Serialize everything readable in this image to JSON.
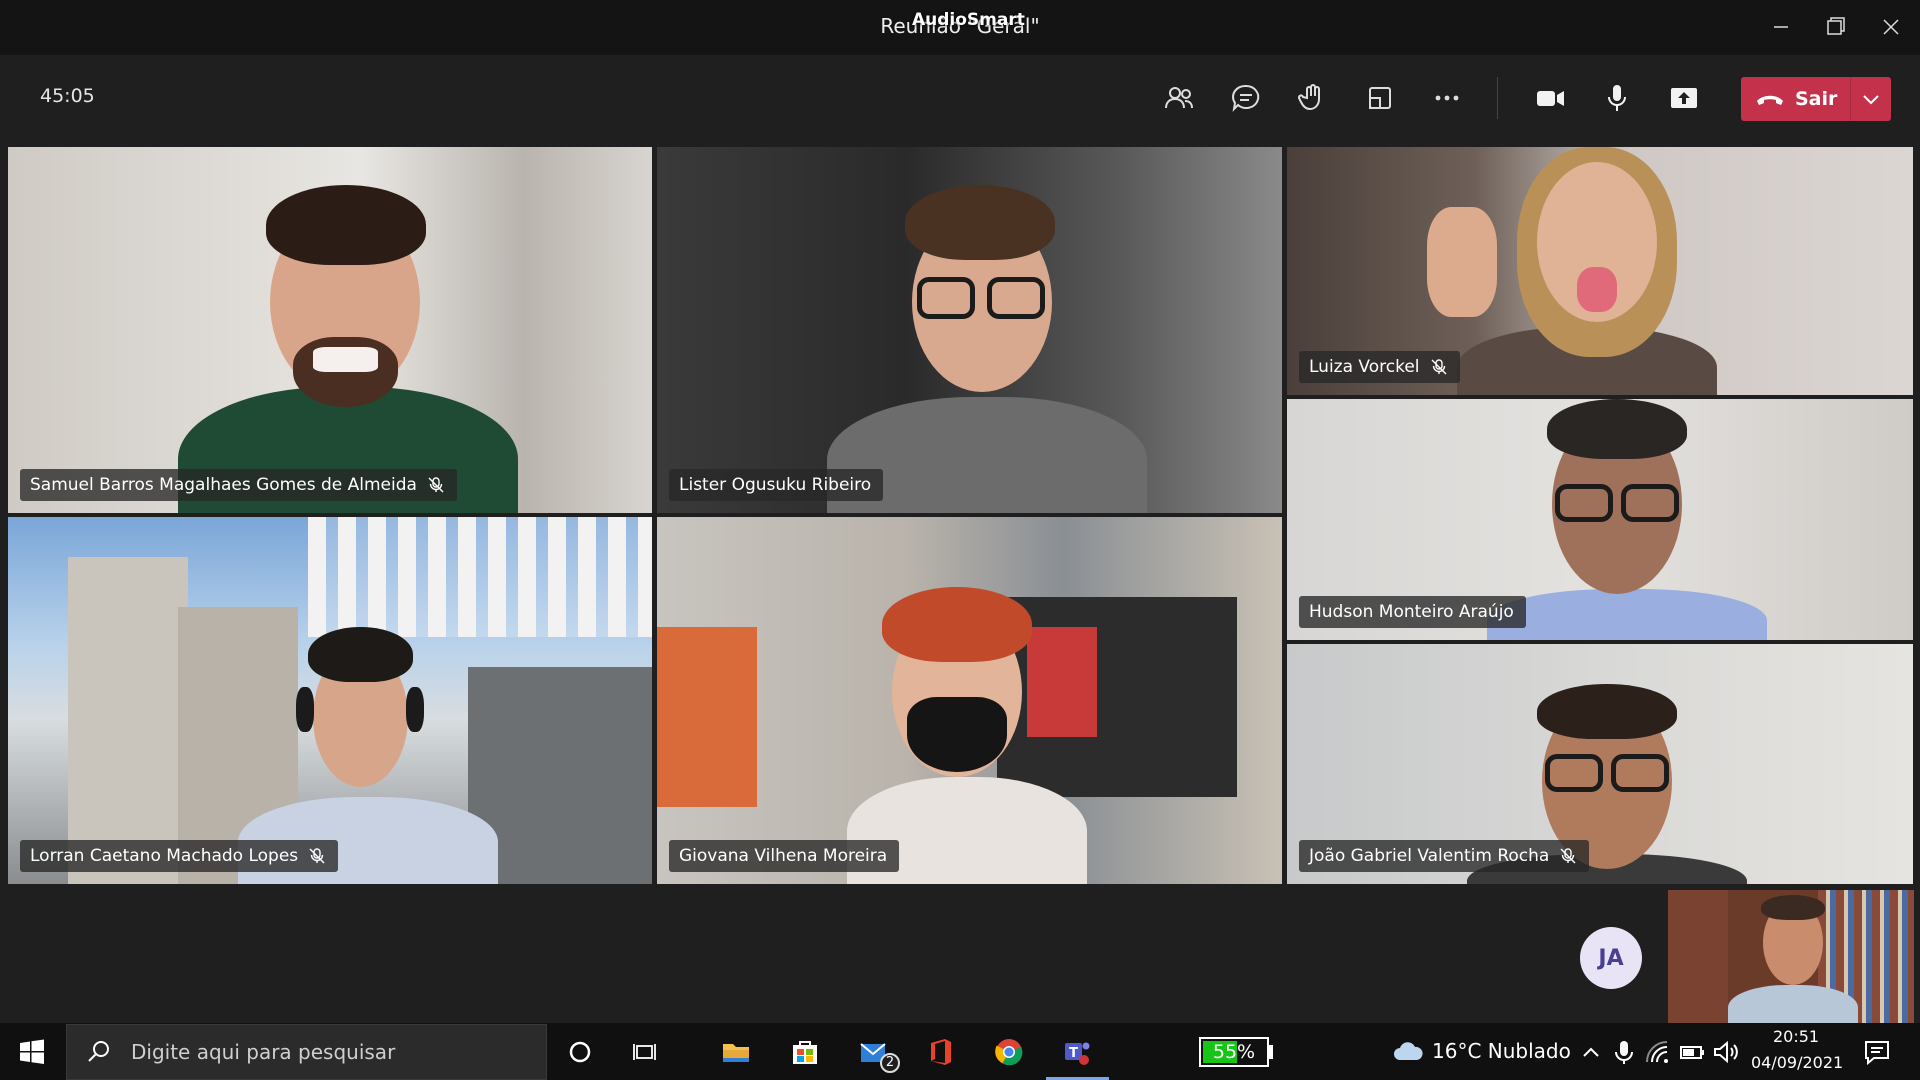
{
  "window": {
    "title": "Reunião \"Geral\"",
    "overlay_label": "AudioSmart"
  },
  "toolbar": {
    "timer": "45:05",
    "leave_label": "Sair",
    "buttons": [
      "participants-icon",
      "chat-icon",
      "raise-hand-icon",
      "rooms-icon",
      "more-icon",
      "camera-icon",
      "mic-icon",
      "share-icon"
    ]
  },
  "participants": [
    {
      "name": "Samuel Barros Magalhaes Gomes de Almeida",
      "muted": true
    },
    {
      "name": "Lister Ogusuku Ribeiro",
      "muted": false
    },
    {
      "name": "Luiza Vorckel",
      "muted": true
    },
    {
      "name": "Hudson Monteiro Araújo",
      "muted": false
    },
    {
      "name": "Lorran Caetano Machado Lopes",
      "muted": true
    },
    {
      "name": "Giovana Vilhena Moreira",
      "muted": false
    },
    {
      "name": "João Gabriel Valentim Rocha",
      "muted": true
    }
  ],
  "self": {
    "initials": "JA"
  },
  "taskbar": {
    "search_placeholder": "Digite aqui para pesquisar",
    "mail_badge": "2",
    "battery_percent": "55%",
    "battery_level": 0.55,
    "weather": "16°C  Nublado",
    "time": "20:51",
    "date": "04/09/2021"
  },
  "colors": {
    "leave": "#c4314b",
    "toolbar": "#1f1f1f",
    "taskbar": "#101010",
    "battery": "#19c419"
  }
}
